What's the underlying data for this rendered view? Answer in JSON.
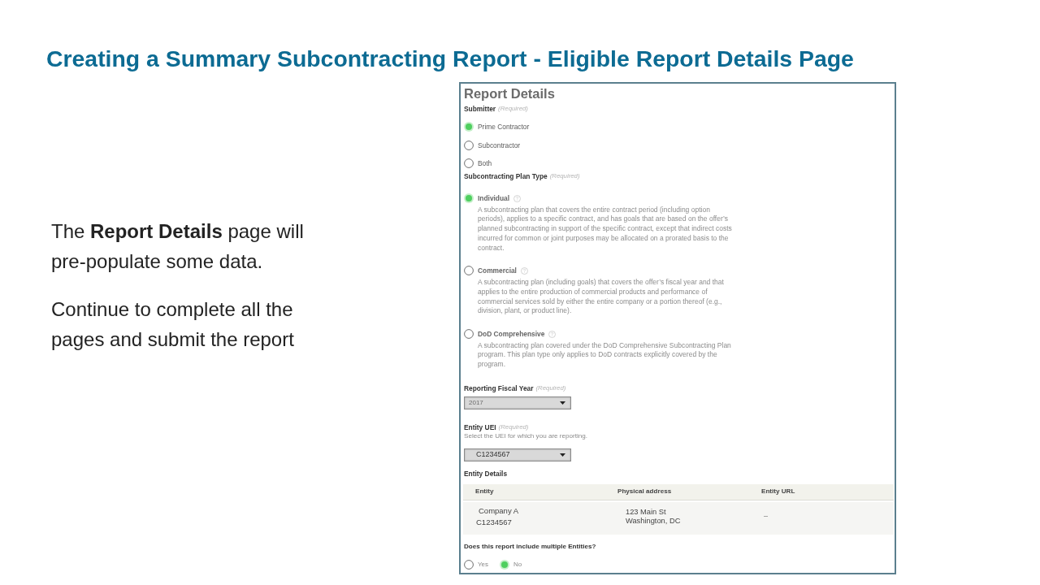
{
  "slide": {
    "title": "Creating a Summary Subcontracting Report - Eligible Report Details Page",
    "paragraphs": [
      "The **Report Details** page will pre-populate some data.",
      "Continue to complete all the pages and submit the report"
    ]
  },
  "report_details": {
    "heading": "Report Details",
    "submitter": {
      "label": "Submitter",
      "note": "(Required)",
      "options": [
        {
          "label": "Prime Contractor",
          "selected": true
        },
        {
          "label": "Subcontractor",
          "selected": false
        },
        {
          "label": "Both",
          "selected": false
        }
      ]
    },
    "plan_type": {
      "label": "Subcontracting Plan Type",
      "note": "(Required)",
      "options": [
        {
          "label": "Individual",
          "selected": true,
          "description": "A subcontracting plan that covers the entire contract period (including option periods), applies to a specific contract, and has goals that are based on the offer’s planned subcontracting in support of the specific contract, except that indirect costs incurred for common or joint purposes may be allocated on a prorated basis to the contract."
        },
        {
          "label": "Commercial",
          "selected": false,
          "description": "A subcontracting plan (including goals) that covers the offer’s fiscal year and that applies to the entire production of commercial products and performance of commercial services sold by either the entire company or a portion thereof (e.g., division, plant, or product line)."
        },
        {
          "label": "DoD Comprehensive",
          "selected": false,
          "description": "A subcontracting plan covered under the DoD Comprehensive Subcontracting Plan program. This plan type only applies to DoD contracts explicitly covered by the program."
        }
      ]
    },
    "fiscal_year": {
      "label": "Reporting Fiscal Year",
      "note": "(Required)",
      "value": "2017"
    },
    "entity_uei": {
      "label": "Entity UEI",
      "note": "(Required)",
      "hint": "Select the UEI for which you are reporting.",
      "value": "C1234567"
    },
    "entity_details": {
      "label": "Entity Details",
      "columns": [
        "Entity",
        "Physical address",
        "Entity URL"
      ],
      "rows": [
        {
          "entity_name": "Company A",
          "entity_uei": "C1234567",
          "address": "123 Main St\nWashington, DC",
          "url": "–"
        }
      ]
    },
    "multiple_entities": {
      "question": "Does this report include multiple Entities?",
      "options": [
        {
          "label": "Yes",
          "selected": false
        },
        {
          "label": "No",
          "selected": true
        }
      ]
    }
  }
}
